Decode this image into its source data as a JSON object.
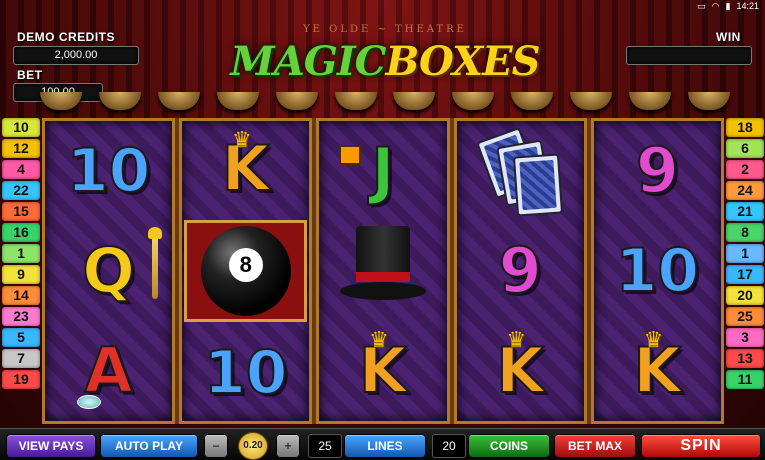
{
  "status": {
    "time": "14:21",
    "icons": [
      "cast-icon",
      "wifi-icon",
      "battery-icon"
    ]
  },
  "hud": {
    "credits_label": "DEMO CREDITS",
    "credits_value": "2,000.00",
    "bet_label": "BET",
    "bet_value": "100.00",
    "win_label": "WIN",
    "win_value": ""
  },
  "title": {
    "part1": "MAGIC",
    "part2": "BOXES",
    "arch": "YE OLDE ~ THEATRE"
  },
  "left_markers": [
    {
      "label": "10",
      "color": "#d6e83a"
    },
    {
      "label": "12",
      "color": "#f2c200"
    },
    {
      "label": "4",
      "color": "#ff5aa8"
    },
    {
      "label": "22",
      "color": "#35c6ff"
    },
    {
      "label": "15",
      "color": "#ff6a3a"
    },
    {
      "label": "16",
      "color": "#38d46a"
    },
    {
      "label": "1",
      "color": "#8fe36a"
    },
    {
      "label": "9",
      "color": "#f2e23a"
    },
    {
      "label": "14",
      "color": "#ff8c3a"
    },
    {
      "label": "23",
      "color": "#ff7ad0"
    },
    {
      "label": "5",
      "color": "#3ab8ff"
    },
    {
      "label": "7",
      "color": "#c7c7c7"
    },
    {
      "label": "19",
      "color": "#ff4a4a"
    }
  ],
  "right_markers": [
    {
      "label": "18",
      "color": "#f2c200"
    },
    {
      "label": "6",
      "color": "#a3e35a"
    },
    {
      "label": "2",
      "color": "#ff5a8c"
    },
    {
      "label": "24",
      "color": "#ff9a3a"
    },
    {
      "label": "21",
      "color": "#35c6ff"
    },
    {
      "label": "8",
      "color": "#4ad46a"
    },
    {
      "label": "1",
      "color": "#6ab8ff"
    },
    {
      "label": "17",
      "color": "#3ab8ff"
    },
    {
      "label": "20",
      "color": "#f2e23a"
    },
    {
      "label": "25",
      "color": "#ff8c3a"
    },
    {
      "label": "3",
      "color": "#ff6ac2"
    },
    {
      "label": "13",
      "color": "#ff4a4a"
    },
    {
      "label": "11",
      "color": "#38d46a"
    }
  ],
  "reels": [
    [
      {
        "type": "letter",
        "text": "10",
        "cls": "sym-10"
      },
      {
        "type": "letter",
        "text": "Q",
        "cls": "sym-Q",
        "extra": "wand"
      },
      {
        "type": "letter",
        "text": "A",
        "cls": "sym-A",
        "extra": "gem"
      }
    ],
    [
      {
        "type": "letter",
        "text": "K",
        "cls": "sym-K",
        "extra": "crown"
      },
      {
        "type": "ball",
        "text": "8"
      },
      {
        "type": "letter",
        "text": "10",
        "cls": "sym-10"
      }
    ],
    [
      {
        "type": "letter",
        "text": "J",
        "cls": "sym-J",
        "extra": "gift"
      },
      {
        "type": "hat"
      },
      {
        "type": "letter",
        "text": "K",
        "cls": "sym-K",
        "extra": "crown"
      }
    ],
    [
      {
        "type": "cards"
      },
      {
        "type": "letter",
        "text": "9",
        "cls": "sym-9"
      },
      {
        "type": "letter",
        "text": "K",
        "cls": "sym-K",
        "extra": "crown"
      }
    ],
    [
      {
        "type": "letter",
        "text": "9",
        "cls": "sym-9"
      },
      {
        "type": "letter",
        "text": "10",
        "cls": "sym-10"
      },
      {
        "type": "letter",
        "text": "K",
        "cls": "sym-K",
        "extra": "crown"
      }
    ]
  ],
  "controls": {
    "view_pays": "VIEW PAYS",
    "auto_play": "AUTO PLAY",
    "minus": "−",
    "coin_value": "0.20",
    "plus": "+",
    "lines_value": "25",
    "lines_label": "LINES",
    "coins_value": "20",
    "coins_label": "COINS",
    "bet_max": "BET MAX",
    "spin": "SPIN"
  }
}
